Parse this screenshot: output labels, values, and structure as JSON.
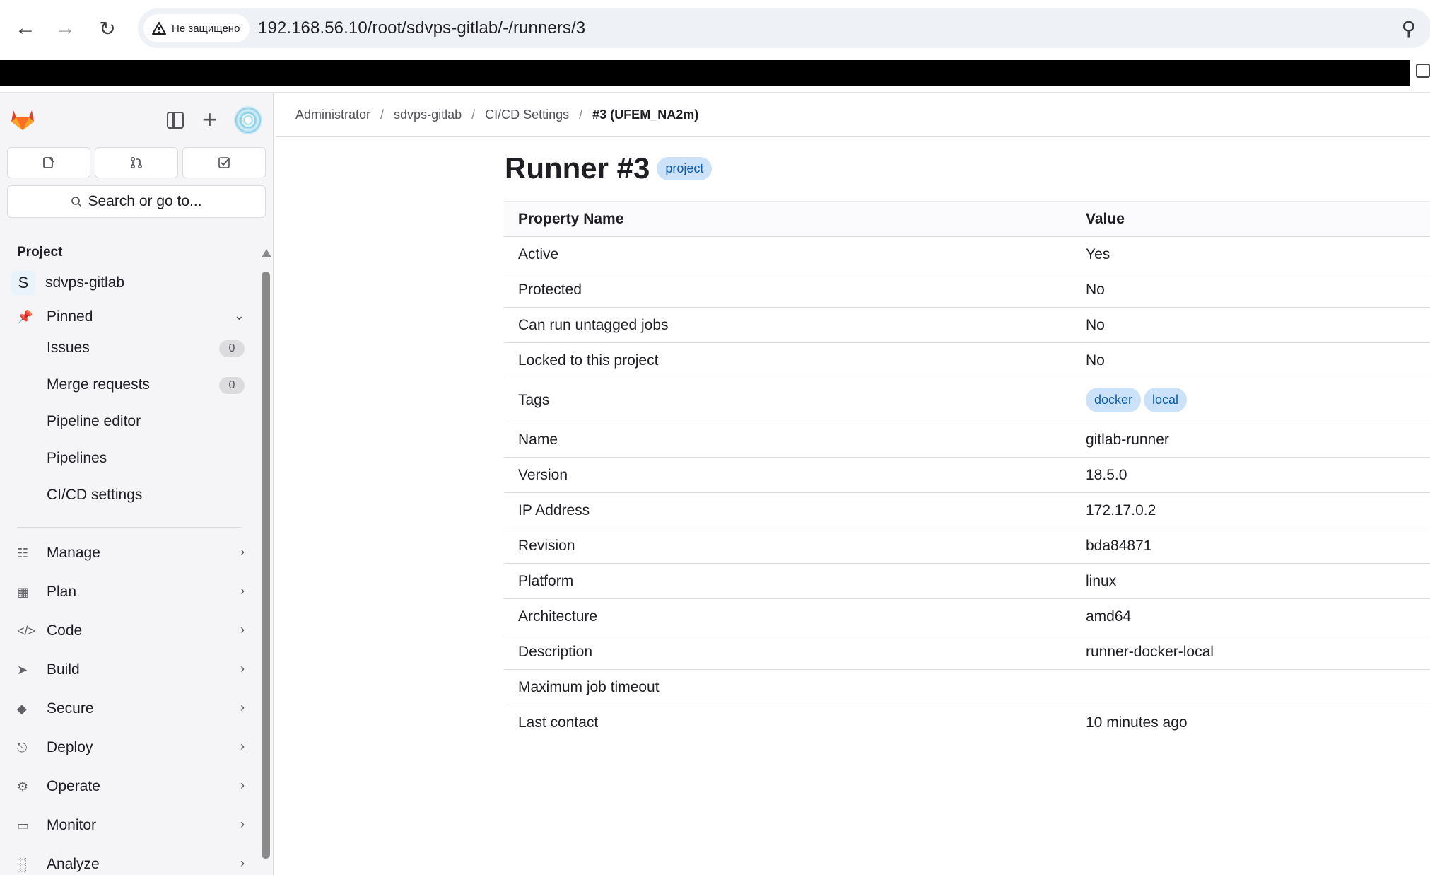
{
  "browser": {
    "security_label": "Не защищено",
    "url": "192.168.56.10/root/sdvps-gitlab/-/runners/3"
  },
  "sidebar": {
    "search_placeholder": "Search or go to...",
    "section_title": "Project",
    "project": {
      "initial": "S",
      "name": "sdvps-gitlab"
    },
    "pinned": {
      "label": "Pinned",
      "items": [
        {
          "label": "Issues",
          "count": "0"
        },
        {
          "label": "Merge requests",
          "count": "0"
        },
        {
          "label": "Pipeline editor"
        },
        {
          "label": "Pipelines"
        },
        {
          "label": "CI/CD settings"
        }
      ]
    },
    "menu": [
      {
        "label": "Manage",
        "icon": "users-icon"
      },
      {
        "label": "Plan",
        "icon": "calendar-icon"
      },
      {
        "label": "Code",
        "icon": "code-icon"
      },
      {
        "label": "Build",
        "icon": "rocket-icon"
      },
      {
        "label": "Secure",
        "icon": "shield-icon"
      },
      {
        "label": "Deploy",
        "icon": "deploy-icon"
      },
      {
        "label": "Operate",
        "icon": "cloud-gear-icon"
      },
      {
        "label": "Monitor",
        "icon": "monitor-icon"
      },
      {
        "label": "Analyze",
        "icon": "chart-icon"
      }
    ]
  },
  "breadcrumb": [
    "Administrator",
    "sdvps-gitlab",
    "CI/CD Settings",
    "#3 (UFEM_NA2m)"
  ],
  "page": {
    "title": "Runner #3",
    "badge": "project"
  },
  "table": {
    "headers": [
      "Property Name",
      "Value"
    ],
    "rows": [
      {
        "name": "Active",
        "value": "Yes"
      },
      {
        "name": "Protected",
        "value": "No"
      },
      {
        "name": "Can run untagged jobs",
        "value": "No"
      },
      {
        "name": "Locked to this project",
        "value": "No"
      },
      {
        "name": "Tags",
        "tags": [
          "docker",
          "local"
        ]
      },
      {
        "name": "Name",
        "value": "gitlab-runner"
      },
      {
        "name": "Version",
        "value": "18.5.0"
      },
      {
        "name": "IP Address",
        "value": "172.17.0.2"
      },
      {
        "name": "Revision",
        "value": "bda84871"
      },
      {
        "name": "Platform",
        "value": "linux"
      },
      {
        "name": "Architecture",
        "value": "amd64"
      },
      {
        "name": "Description",
        "value": "runner-docker-local"
      },
      {
        "name": "Maximum job timeout",
        "value": ""
      },
      {
        "name": "Last contact",
        "value": "10 minutes ago"
      }
    ]
  },
  "colors": {
    "badge_bg": "#cbe2f9",
    "badge_text": "#0b5cad",
    "sidebar_bg": "#f5f5f7"
  }
}
